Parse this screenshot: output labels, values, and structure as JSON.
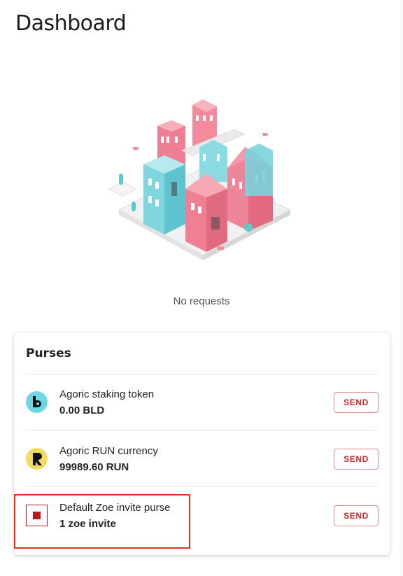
{
  "header": {
    "title": "Dashboard"
  },
  "requests": {
    "empty_text": "No requests"
  },
  "purses": {
    "title": "Purses",
    "items": [
      {
        "name": "Agoric staking token",
        "amount": "0.00 BLD",
        "icon": "bld-token-icon",
        "icon_color": "#6fd6e3",
        "send_label": "SEND"
      },
      {
        "name": "Agoric RUN currency",
        "amount": "99989.60 RUN",
        "icon": "run-token-icon",
        "icon_color": "#f0dc5e",
        "send_label": "SEND"
      },
      {
        "name": "Default Zoe invite purse",
        "amount": "1 zoe invite",
        "icon": "zoe-invite-icon",
        "icon_color": "#b71c1c",
        "send_label": "SEND"
      }
    ]
  },
  "colors": {
    "accent": "#c62828",
    "highlight": "#e0301e"
  }
}
